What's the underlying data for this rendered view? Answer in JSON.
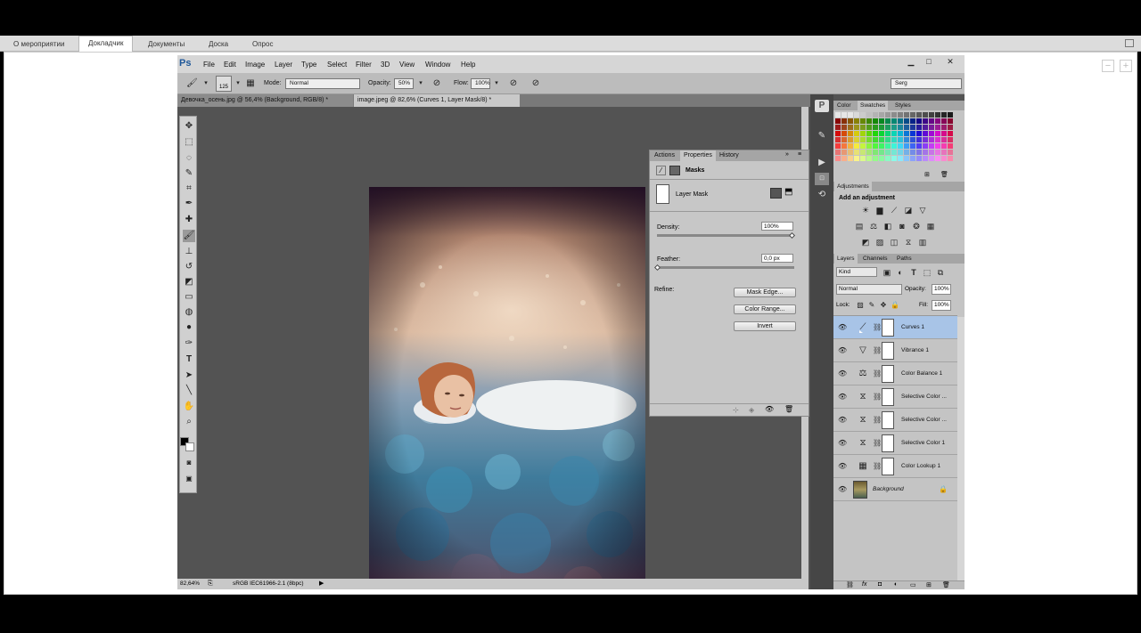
{
  "browser_tabs": [
    "О мероприятии",
    "Докладчик",
    "Документы",
    "Доска",
    "Опрос"
  ],
  "ps": {
    "logo": "Ps",
    "menu": [
      "File",
      "Edit",
      "Image",
      "Layer",
      "Type",
      "Select",
      "Filter",
      "3D",
      "View",
      "Window",
      "Help"
    ],
    "options": {
      "brush_size": "125",
      "mode_label": "Mode:",
      "mode_value": "Normal",
      "opacity_label": "Opacity:",
      "opacity_value": "50%",
      "flow_label": "Flow:",
      "flow_value": "100%",
      "workspace": "Serg"
    },
    "doc_tabs": [
      "Девочка_осень.jpg @ 56,4% (Background, RGB/8) *",
      "image.jpeg @ 82,6% (Curves 1, Layer Mask/8) *"
    ],
    "status": {
      "zoom": "82,64%",
      "profile": "sRGB IEC61966-2.1 (8bpc)"
    },
    "properties": {
      "tabs": [
        "Actions",
        "Properties",
        "History"
      ],
      "header": "Masks",
      "layer_mask": "Layer Mask",
      "density_label": "Density:",
      "density_value": "100%",
      "feather_label": "Feather:",
      "feather_value": "0,0 px",
      "refine_label": "Refine:",
      "buttons": [
        "Mask Edge...",
        "Color Range...",
        "Invert"
      ]
    },
    "color_panel": {
      "tabs": [
        "Color",
        "Swatches",
        "Styles"
      ]
    },
    "adjustments": {
      "title": "Adjustments",
      "subtitle": "Add an adjustment"
    },
    "layers_panel": {
      "tabs": [
        "Layers",
        "Channels",
        "Paths"
      ],
      "kind": "Kind",
      "blend": "Normal",
      "opacity_label": "Opacity:",
      "opacity_value": "100%",
      "lock_label": "Lock:",
      "fill_label": "Fill:",
      "fill_value": "100%",
      "layers": [
        {
          "name": "Curves 1",
          "icon": "curves-icon",
          "selected": true
        },
        {
          "name": "Vibrance 1",
          "icon": "vibrance-icon"
        },
        {
          "name": "Color Balance 1",
          "icon": "balance-icon"
        },
        {
          "name": "Selective Color ...",
          "icon": "selective-color-icon"
        },
        {
          "name": "Selective Color ...",
          "icon": "selective-color-icon"
        },
        {
          "name": "Selective Color 1",
          "icon": "selective-color-icon"
        },
        {
          "name": "Color Lookup 1",
          "icon": "lookup-grid-icon"
        },
        {
          "name": "Background",
          "icon": "thumbnail"
        }
      ]
    }
  },
  "colors": {
    "ps_bg": "#535353",
    "ui_light": "#c4c4c4",
    "selection": "#a8c4e7",
    "ps_blue": "#1e5799"
  }
}
